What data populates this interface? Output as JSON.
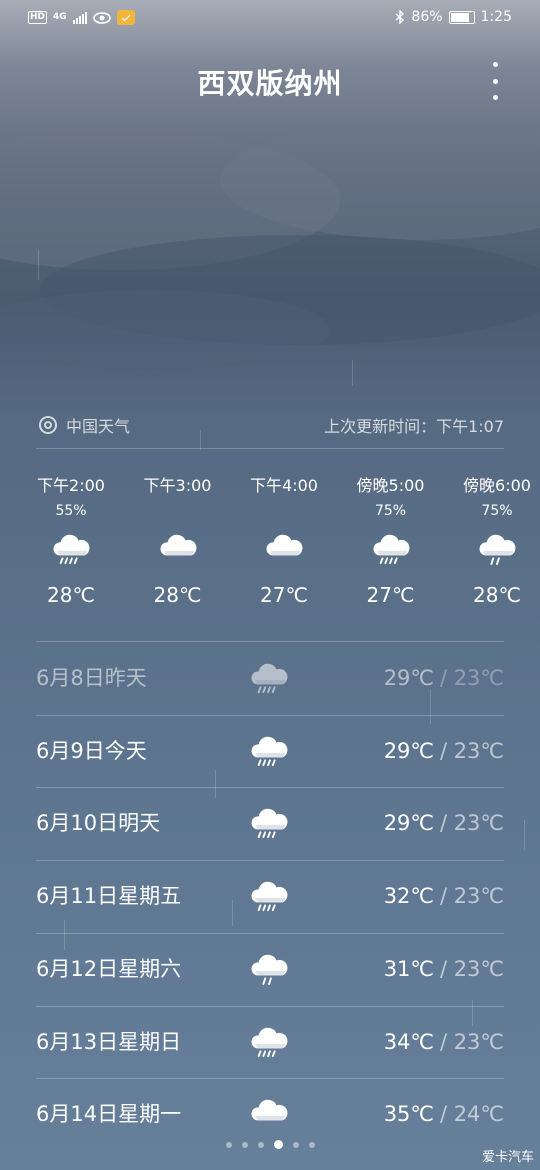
{
  "status": {
    "net": "4G",
    "battery": "86%",
    "time": "1:25"
  },
  "title": "西双版纳州",
  "source": "中国天气",
  "updated": "上次更新时间：下午1:07",
  "hourly": [
    {
      "time": "下午2:00",
      "precip": "55%",
      "icon": "rain-cloud-icon",
      "temp": "28℃"
    },
    {
      "time": "下午3:00",
      "precip": "",
      "icon": "cloud-icon",
      "temp": "28℃"
    },
    {
      "time": "下午4:00",
      "precip": "",
      "icon": "cloud-icon",
      "temp": "27℃"
    },
    {
      "time": "傍晚5:00",
      "precip": "75%",
      "icon": "rain-cloud-icon",
      "temp": "27℃"
    },
    {
      "time": "傍晚6:00",
      "precip": "75%",
      "icon": "light-rain-cloud-icon",
      "temp": "28℃"
    }
  ],
  "daily": [
    {
      "date": "6月8日昨天",
      "icon": "rain-cloud-icon",
      "high": "29℃",
      "low": "/ 23℃"
    },
    {
      "date": "6月9日今天",
      "icon": "rain-cloud-icon",
      "high": "29℃",
      "low": "/ 23℃"
    },
    {
      "date": "6月10日明天",
      "icon": "rain-cloud-icon",
      "high": "29℃",
      "low": "/ 23℃"
    },
    {
      "date": "6月11日星期五",
      "icon": "rain-cloud-icon",
      "high": "32℃",
      "low": "/ 23℃"
    },
    {
      "date": "6月12日星期六",
      "icon": "light-rain-cloud-icon",
      "high": "31℃",
      "low": "/ 23℃"
    },
    {
      "date": "6月13日星期日",
      "icon": "rain-cloud-icon",
      "high": "34℃",
      "low": "/ 23℃"
    },
    {
      "date": "6月14日星期一",
      "icon": "cloud-icon",
      "high": "35℃",
      "low": "/ 24℃"
    }
  ],
  "pager": {
    "count": 6,
    "active": 3
  },
  "watermark": "爱卡汽车"
}
